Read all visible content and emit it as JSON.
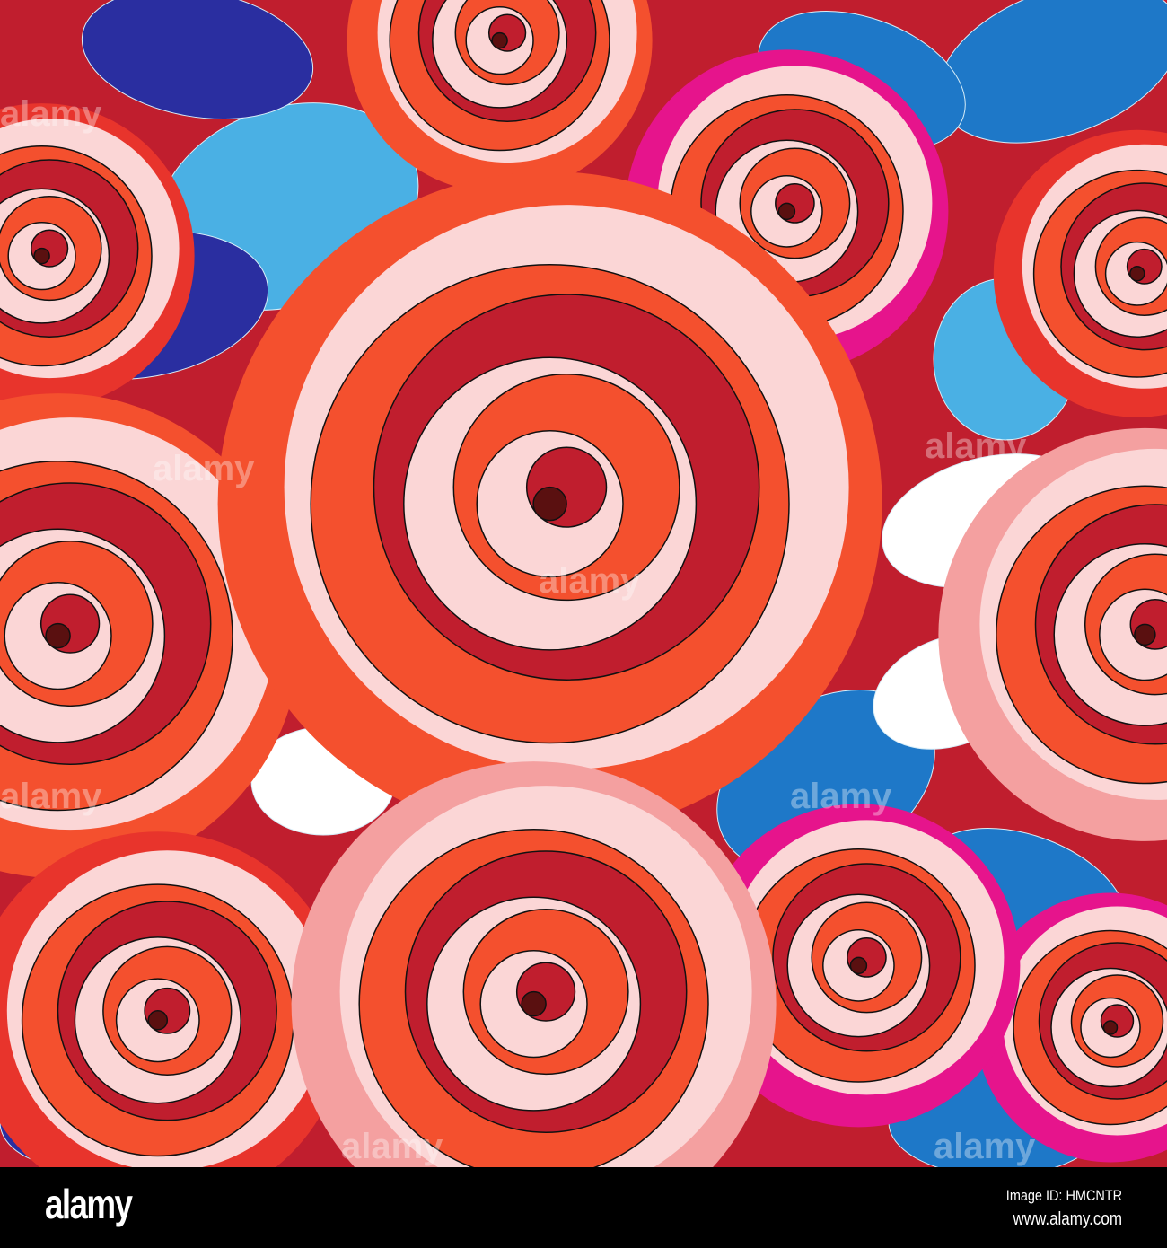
{
  "watermark": "alamy",
  "footer": {
    "logo": "alamy",
    "image_id": "Image ID: HMCNTR",
    "website": "www.alamy.com"
  },
  "colors": {
    "red": "#e8342c",
    "dark_red": "#c01e2e",
    "orange_red": "#f4502e",
    "pink": "#f4a0a0",
    "pale_pink": "#fbd6d6",
    "magenta": "#e6148c",
    "light_blue": "#4ab0e4",
    "blue": "#1e78c8",
    "navy": "#2a2ea0"
  }
}
